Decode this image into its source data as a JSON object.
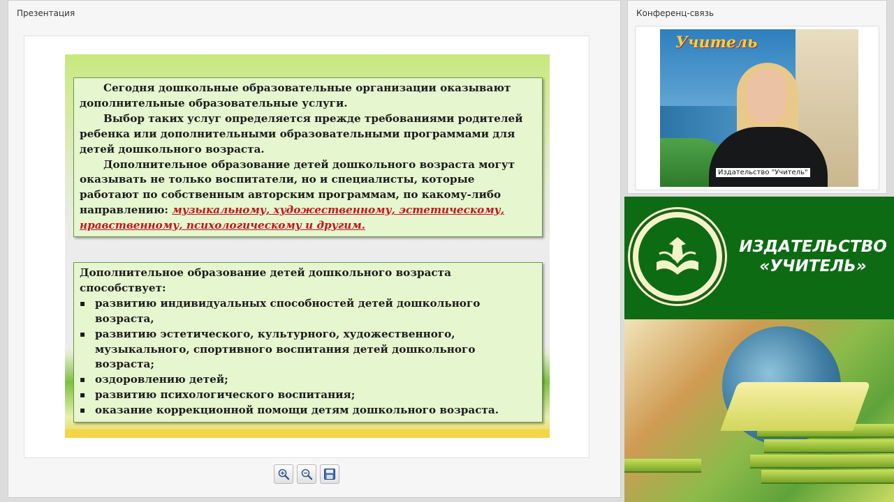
{
  "presentation_panel": {
    "title": "Презентация",
    "slide": {
      "box1": {
        "p1": "Сегодня дошкольные образовательные организации  оказывают дополнительные образовательные услуги.",
        "p2": "Выбор таких услуг определяется прежде требованиями родителей ребенка или дополнительными образовательными программами для детей дошкольного возраста.",
        "p3_start": "Дополнительное образование детей дошкольного возраста могут оказывать не только воспитатели, но и специалисты, которые работают по собственным авторским программам, по какому-либо направлению: ",
        "p3_highlight": "музыкальному, художественному, эстетическому, нравственному, психологическому и другим."
      },
      "box2": {
        "intro": "Дополнительное образование детей дошкольного возраста способствует:",
        "items": [
          "развитию индивидуальных способностей детей дошкольного возраста,",
          "развитию эстетического, культурного, художественного, музыкального, спортивного воспитания детей дошкольного возраста;",
          "оздоровлению детей;",
          "развитию психологического воспитания;",
          "оказание коррекционной помощи детям дошкольного возраста."
        ]
      }
    },
    "toolbar": {
      "zoom_in_icon": "zoom-in-icon",
      "zoom_out_icon": "zoom-out-icon",
      "save_icon": "save-icon"
    }
  },
  "conference_panel": {
    "title": "Конференц-связь",
    "video": {
      "logo_text": "Учитель",
      "caption": "Издательство \"Учитель\""
    }
  },
  "ad_banner": {
    "line1": "ИЗДАТЕЛЬСТВО",
    "line2": "«УЧИТЕЛЬ»"
  },
  "colors": {
    "slide_green": "#c6e87c",
    "box_fill": "#e6f6cf",
    "highlight_red": "#c4151c",
    "ad_green": "#0d6b14"
  }
}
